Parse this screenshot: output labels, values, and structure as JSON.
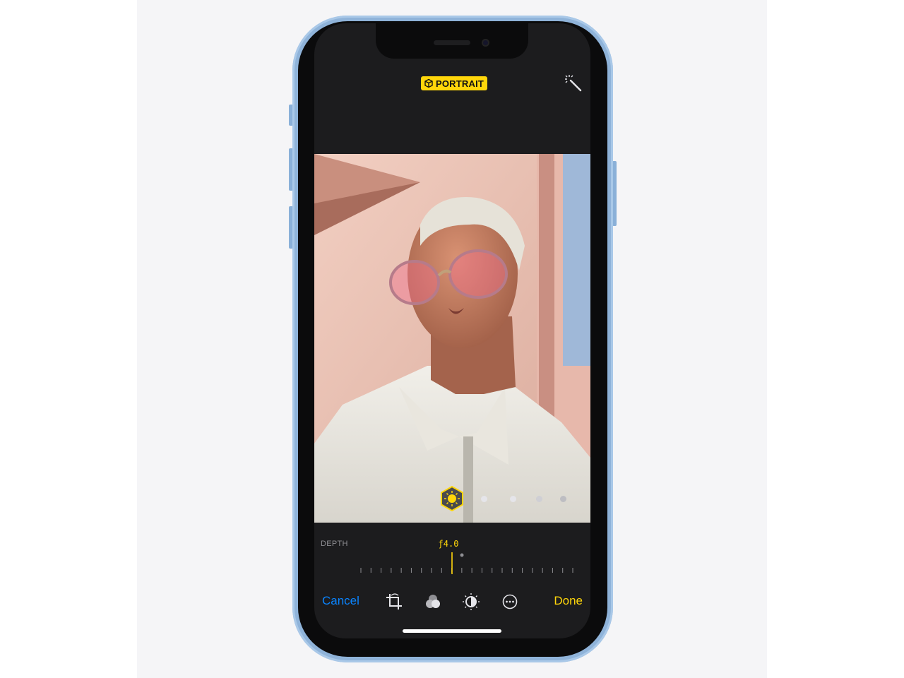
{
  "header": {
    "badge_label": "PORTRAIT",
    "edit_icon": "magic-wand-icon"
  },
  "editor": {
    "depth_label": "DEPTH",
    "aperture_value": "ƒ4.0",
    "depth_level": 0.43
  },
  "lighting": {
    "selected": "natural-light",
    "options": [
      "natural-light",
      "studio-light",
      "contour-light",
      "stage-light",
      "stage-light-mono"
    ]
  },
  "toolbar": {
    "cancel_label": "Cancel",
    "done_label": "Done",
    "icons": [
      "crop-rotate-icon",
      "filters-icon",
      "adjust-icon",
      "more-icon"
    ]
  },
  "colors": {
    "accent_yellow": "#ffd60a",
    "link_blue": "#0a84ff",
    "screen_bg": "#1c1c1e",
    "phone_frame": "#8fb3d9"
  }
}
